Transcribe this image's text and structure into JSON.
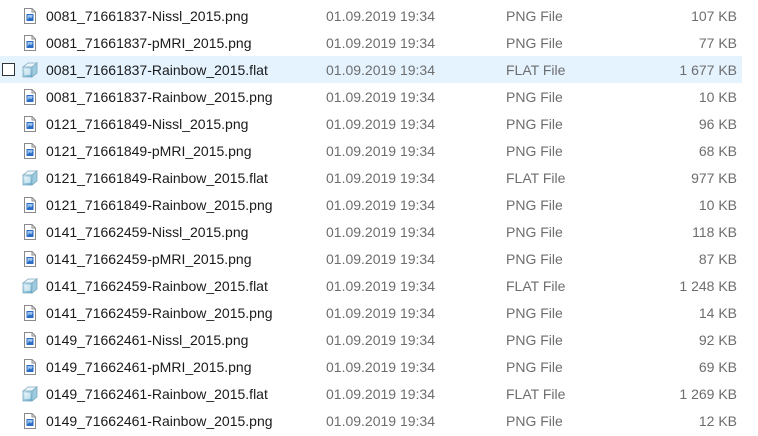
{
  "files": [
    {
      "name": "0081_71661837-Nissl_2015.png",
      "date": "01.09.2019 19:34",
      "type": "PNG File",
      "size": "107 KB",
      "icon": "png-file-icon"
    },
    {
      "name": "0081_71661837-pMRI_2015.png",
      "date": "01.09.2019 19:34",
      "type": "PNG File",
      "size": "77 KB",
      "icon": "png-file-icon"
    },
    {
      "name": "0081_71661837-Rainbow_2015.flat",
      "date": "01.09.2019 19:34",
      "type": "FLAT File",
      "size": "1 677 KB",
      "icon": "flat-file-icon",
      "hover": true,
      "checkbox": true
    },
    {
      "name": "0081_71661837-Rainbow_2015.png",
      "date": "01.09.2019 19:34",
      "type": "PNG File",
      "size": "10 KB",
      "icon": "png-file-icon"
    },
    {
      "name": "0121_71661849-Nissl_2015.png",
      "date": "01.09.2019 19:34",
      "type": "PNG File",
      "size": "96 KB",
      "icon": "png-file-icon"
    },
    {
      "name": "0121_71661849-pMRI_2015.png",
      "date": "01.09.2019 19:34",
      "type": "PNG File",
      "size": "68 KB",
      "icon": "png-file-icon"
    },
    {
      "name": "0121_71661849-Rainbow_2015.flat",
      "date": "01.09.2019 19:34",
      "type": "FLAT File",
      "size": "977 KB",
      "icon": "flat-file-icon"
    },
    {
      "name": "0121_71661849-Rainbow_2015.png",
      "date": "01.09.2019 19:34",
      "type": "PNG File",
      "size": "10 KB",
      "icon": "png-file-icon"
    },
    {
      "name": "0141_71662459-Nissl_2015.png",
      "date": "01.09.2019 19:34",
      "type": "PNG File",
      "size": "118 KB",
      "icon": "png-file-icon"
    },
    {
      "name": "0141_71662459-pMRI_2015.png",
      "date": "01.09.2019 19:34",
      "type": "PNG File",
      "size": "87 KB",
      "icon": "png-file-icon"
    },
    {
      "name": "0141_71662459-Rainbow_2015.flat",
      "date": "01.09.2019 19:34",
      "type": "FLAT File",
      "size": "1 248 KB",
      "icon": "flat-file-icon"
    },
    {
      "name": "0141_71662459-Rainbow_2015.png",
      "date": "01.09.2019 19:34",
      "type": "PNG File",
      "size": "14 KB",
      "icon": "png-file-icon"
    },
    {
      "name": "0149_71662461-Nissl_2015.png",
      "date": "01.09.2019 19:34",
      "type": "PNG File",
      "size": "92 KB",
      "icon": "png-file-icon"
    },
    {
      "name": "0149_71662461-pMRI_2015.png",
      "date": "01.09.2019 19:34",
      "type": "PNG File",
      "size": "69 KB",
      "icon": "png-file-icon"
    },
    {
      "name": "0149_71662461-Rainbow_2015.flat",
      "date": "01.09.2019 19:34",
      "type": "FLAT File",
      "size": "1 269 KB",
      "icon": "flat-file-icon"
    },
    {
      "name": "0149_71662461-Rainbow_2015.png",
      "date": "01.09.2019 19:34",
      "type": "PNG File",
      "size": "12 KB",
      "icon": "png-file-icon"
    }
  ],
  "colors": {
    "hover_background": "#e5f3ff",
    "secondary_text": "#6d6d6d",
    "png_icon_accent": "#2b6cc4",
    "flat_icon_accent": "#5ba6c9"
  }
}
